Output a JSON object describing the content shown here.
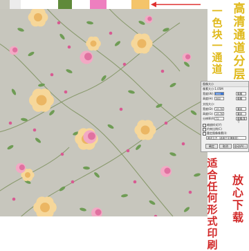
{
  "swatches": {
    "colors": [
      "#c9c8bf",
      "#ececec",
      "#ffffff",
      "#5f8a3a",
      "#ffffff",
      "#ee7fbf",
      "#ffffff",
      "#f4c46a"
    ],
    "arrow_color": "#e03030"
  },
  "pattern": {
    "background": "#c7c6bd",
    "flower_colors": {
      "rose": "#f2a9c4",
      "rose_dark": "#d85a92",
      "peony": "#f6d79a",
      "peony_dark": "#e8ae55",
      "leaf": "#6f9c55",
      "leaf_dark": "#4c7a3a",
      "stem": "#7b8f5a"
    }
  },
  "headline_right": {
    "chars": [
      "高",
      "清",
      "通",
      "道",
      "分",
      "层"
    ],
    "color": "#e0b91a"
  },
  "headline_left": {
    "chars": [
      "一",
      "色",
      "块",
      "一",
      "通",
      "道"
    ],
    "color": "#e0b91a"
  },
  "bottom_left": {
    "chars": [
      "适",
      "合",
      "任",
      "何",
      "形",
      "式",
      "印",
      "刷"
    ],
    "color": "#d22a2a"
  },
  "bottom_right": {
    "chars": [
      "放",
      "心",
      "下",
      "载"
    ],
    "color": "#d22a2a"
  },
  "dialog": {
    "title": "图像大小",
    "pixel_header": "像素大小:1.05M",
    "width_label": "宽度(W):",
    "width_value": "560",
    "height_label": "高度(H):",
    "height_value": "560",
    "px_unit": "像素",
    "doc_header": "文档大小:",
    "doc_width_label": "宽度(D):",
    "doc_width_value": "19.76",
    "doc_height_label": "高度(G):",
    "doc_height_value": "19.76",
    "cm_unit": "厘米",
    "res_label": "分辨率(R):",
    "res_value": "72",
    "res_unit": "像素/英寸",
    "opt_scale": "缩放样式(Y)",
    "opt_constrain": "约束比例(C)",
    "opt_resample": "重定图像像素(I):",
    "resample_mode": "两次立方（适用于平滑渐变）",
    "ok_label": "确定",
    "cancel_label": "取消",
    "auto_label": "自动(A)..."
  }
}
